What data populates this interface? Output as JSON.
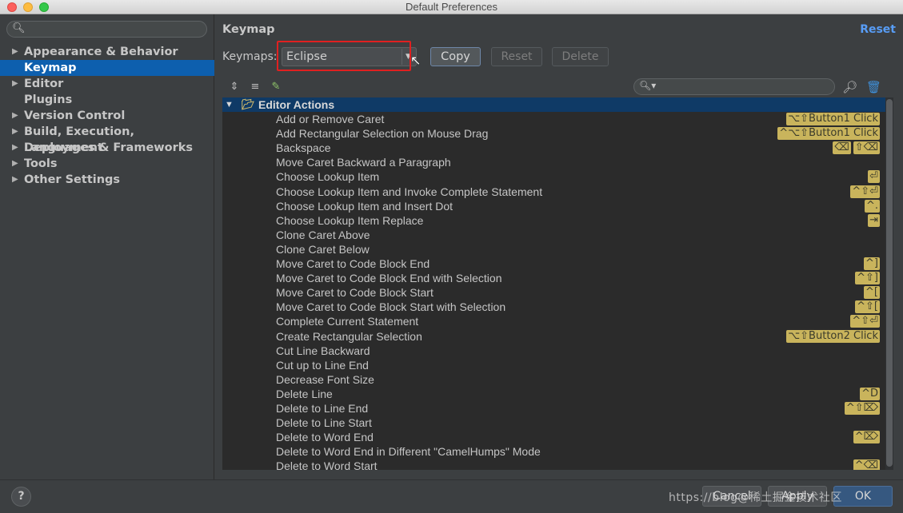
{
  "window": {
    "title": "Default Preferences"
  },
  "sidebar": {
    "search_icon": "search-icon",
    "items": [
      {
        "label": "Appearance & Behavior",
        "expandable": true,
        "selected": false
      },
      {
        "label": "Keymap",
        "expandable": false,
        "selected": true
      },
      {
        "label": "Editor",
        "expandable": true,
        "selected": false
      },
      {
        "label": "Plugins",
        "expandable": false,
        "selected": false
      },
      {
        "label": "Version Control",
        "expandable": true,
        "selected": false
      },
      {
        "label": "Build, Execution, Deployment",
        "expandable": true,
        "selected": false
      },
      {
        "label": "Languages & Frameworks",
        "expandable": true,
        "selected": false
      },
      {
        "label": "Tools",
        "expandable": true,
        "selected": false
      },
      {
        "label": "Other Settings",
        "expandable": true,
        "selected": false
      }
    ]
  },
  "main": {
    "heading": "Keymap",
    "reset_link": "Reset",
    "keymaps_label": "Keymaps:",
    "keymap_selected": "Eclipse",
    "buttons": {
      "copy": "Copy",
      "reset": "Reset",
      "delete": "Delete"
    },
    "colors": {
      "accent": "#589df6",
      "highlight_box": "#e02020",
      "shortcut_bg": "#c9b45c",
      "selection": "#0d5fae"
    }
  },
  "list": {
    "group": "Editor Actions",
    "actions": [
      {
        "name": "Add or Remove Caret",
        "shortcuts": [
          "⌥⇧Button1 Click"
        ]
      },
      {
        "name": "Add Rectangular Selection on Mouse Drag",
        "shortcuts": [
          "^⌥⇧Button1 Click"
        ]
      },
      {
        "name": "Backspace",
        "shortcuts": [
          "⌫",
          "⇧⌫"
        ]
      },
      {
        "name": "Move Caret Backward a Paragraph",
        "shortcuts": []
      },
      {
        "name": "Choose Lookup Item",
        "shortcuts": [
          "⏎"
        ]
      },
      {
        "name": "Choose Lookup Item and Invoke Complete Statement",
        "shortcuts": [
          "^⇧⏎"
        ]
      },
      {
        "name": "Choose Lookup Item and Insert Dot",
        "shortcuts": [
          "^."
        ]
      },
      {
        "name": "Choose Lookup Item Replace",
        "shortcuts": [
          "⇥"
        ]
      },
      {
        "name": "Clone Caret Above",
        "shortcuts": []
      },
      {
        "name": "Clone Caret Below",
        "shortcuts": []
      },
      {
        "name": "Move Caret to Code Block End",
        "shortcuts": [
          "^]"
        ]
      },
      {
        "name": "Move Caret to Code Block End with Selection",
        "shortcuts": [
          "^⇧]"
        ]
      },
      {
        "name": "Move Caret to Code Block Start",
        "shortcuts": [
          "^["
        ]
      },
      {
        "name": "Move Caret to Code Block Start with Selection",
        "shortcuts": [
          "^⇧["
        ]
      },
      {
        "name": "Complete Current Statement",
        "shortcuts": [
          "^⇧⏎"
        ]
      },
      {
        "name": "Create Rectangular Selection",
        "shortcuts": [
          "⌥⇧Button2 Click"
        ]
      },
      {
        "name": "Cut Line Backward",
        "shortcuts": []
      },
      {
        "name": "Cut up to Line End",
        "shortcuts": []
      },
      {
        "name": "Decrease Font Size",
        "shortcuts": []
      },
      {
        "name": "Delete Line",
        "shortcuts": [
          "^D"
        ]
      },
      {
        "name": "Delete to Line End",
        "shortcuts": [
          "^⇧⌦"
        ]
      },
      {
        "name": "Delete to Line Start",
        "shortcuts": []
      },
      {
        "name": "Delete to Word End",
        "shortcuts": [
          "^⌦"
        ]
      },
      {
        "name": "Delete to Word End in Different \"CamelHumps\" Mode",
        "shortcuts": []
      },
      {
        "name": "Delete to Word Start",
        "shortcuts": [
          "^⌫"
        ]
      }
    ]
  },
  "footer": {
    "help": "?",
    "cancel": "Cancel",
    "apply": "Apply",
    "ok": "OK",
    "watermark": "https://blog@稀土掘金技术社区"
  }
}
